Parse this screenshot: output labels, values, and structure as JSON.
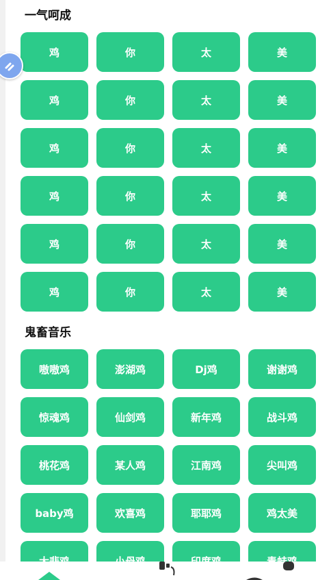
{
  "sections": {
    "yiqi": {
      "title": "一气呵成",
      "rows": [
        [
          "鸡",
          "你",
          "太",
          "美"
        ],
        [
          "鸡",
          "你",
          "太",
          "美"
        ],
        [
          "鸡",
          "你",
          "太",
          "美"
        ],
        [
          "鸡",
          "你",
          "太",
          "美"
        ],
        [
          "鸡",
          "你",
          "太",
          "美"
        ],
        [
          "鸡",
          "你",
          "太",
          "美"
        ]
      ]
    },
    "guichu": {
      "title": "鬼畜音乐",
      "rows": [
        [
          "嗷嗷鸡",
          "澎湖鸡",
          "Dj鸡",
          "谢谢鸡"
        ],
        [
          "惊魂鸡",
          "仙剑鸡",
          "新年鸡",
          "战斗鸡"
        ],
        [
          "桃花鸡",
          "某人鸡",
          "江南鸡",
          "尖叫鸡"
        ],
        [
          "baby鸡",
          "欢喜鸡",
          "耶耶鸡",
          "鸡太美"
        ],
        [
          "大悲鸡",
          "小母鸡",
          "印度鸡",
          "青蛙鸡"
        ]
      ]
    }
  },
  "floating_badge": {
    "icon": "double-chevron-icon"
  },
  "bottom_nav": {
    "items": [
      {
        "icon": "home-icon"
      },
      {
        "icon": "music-icon"
      },
      {
        "icon": "profile-icon"
      }
    ]
  },
  "colors": {
    "key_bg": "#2ccb8a",
    "key_text": "#ffffff",
    "title_text": "#111111",
    "badge_bg": "#7ea6ee"
  }
}
